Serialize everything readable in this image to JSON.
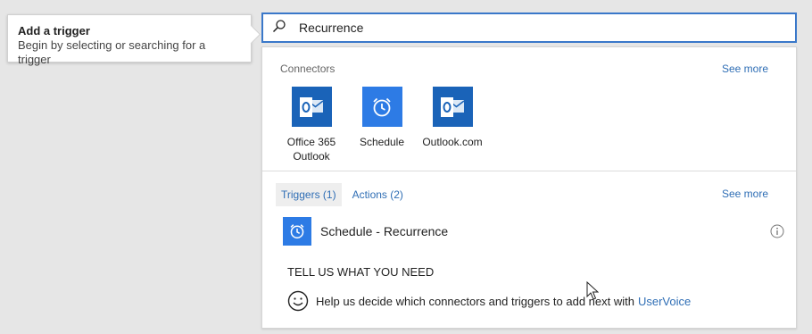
{
  "callout": {
    "title": "Add a trigger",
    "subtitle": "Begin by selecting or searching for a trigger"
  },
  "search": {
    "value": "Recurrence",
    "icon": "search-icon"
  },
  "connectors_section": {
    "title": "Connectors",
    "see_more": "See more",
    "items": [
      {
        "line1": "Office 365",
        "line2": "Outlook",
        "icon": "outlook-icon",
        "color": "#1a63b8"
      },
      {
        "line1": "Schedule",
        "line2": "",
        "icon": "alarm-clock-icon",
        "color": "#2d7be5"
      },
      {
        "line1": "Outlook.com",
        "line2": "",
        "icon": "outlook-icon",
        "color": "#1a63b8"
      }
    ]
  },
  "tabs": {
    "triggers": "Triggers (1)",
    "actions": "Actions (2)",
    "see_more": "See more"
  },
  "trigger": {
    "label": "Schedule - Recurrence",
    "icon": "alarm-clock-icon",
    "color": "#2d7be5"
  },
  "feedback": {
    "heading": "TELL US WHAT YOU NEED",
    "text": "Help us decide which connectors and triggers to add next with",
    "link": "UserVoice"
  },
  "colors": {
    "accent": "#2f6eb5",
    "search_border": "#3a78c9",
    "background": "#e6e6e6"
  }
}
